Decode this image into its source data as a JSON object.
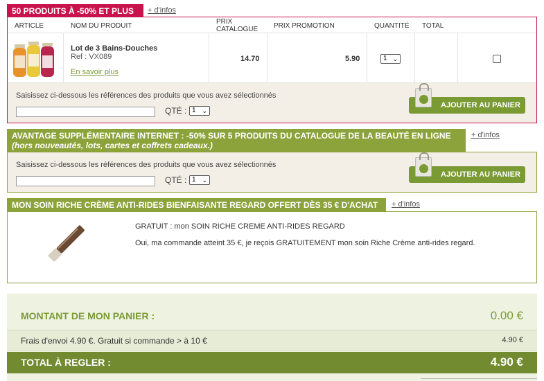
{
  "section1": {
    "tab_title": "50 PRODUITS À -50% ET PLUS",
    "more_link": "+ d'infos",
    "headers": {
      "article": "ARTICLE",
      "product_name": "NOM DU PRODUIT",
      "catalogue_price": "PRIX CATALOGUE",
      "promo_price": "PRIX PROMOTION",
      "quantity": "QUANTITÉ",
      "total": "TOTAL"
    },
    "product": {
      "name": "Lot de 3 Bains-Douches",
      "ref": "Ref : VX089",
      "learn_more": "En savoir plus",
      "catalogue_price": "14.70",
      "promo_price": "5.90",
      "quantity": "1"
    },
    "ref_hint": "Saisissez ci-dessous les références des produits que vous avez sélectionnés",
    "qty_label": "QTÉ :",
    "qty_value": "1",
    "add_button": "AJOUTER AU PANIER"
  },
  "section2": {
    "title_line1": "AVANTAGE SUPPLÉMENTAIRE INTERNET : -50% SUR 5 PRODUITS DU CATALOGUE DE LA BEAUTÉ EN LIGNE",
    "title_line2": "(hors nouveautés, lots, cartes et coffrets cadeaux.)",
    "more_link": "+ d'infos",
    "ref_hint": "Saisissez ci-dessous les références des produits que vous avez sélectionnés",
    "qty_label": "QTÉ :",
    "qty_value": "1",
    "add_button": "AJOUTER AU PANIER"
  },
  "section3": {
    "tab_title": "MON SOIN RICHE CRÈME ANTI-RIDES BIENFAISANTE REGARD OFFERT DÈS 35 € D'ACHAT",
    "more_link": "+ d'infos",
    "gift_title": "GRATUIT : mon SOIN RICHE CREME ANTI-RIDES REGARD",
    "gift_text": "Oui, ma commande atteint 35 €, je reçois GRATUITEMENT mon soin Riche Crème anti-rides regard."
  },
  "totals": {
    "basket_label": "MONTANT DE MON PANIER :",
    "basket_value": "0.00 €",
    "shipping_label": "Frais d'envoi 4.90 €. Gratuit si commande > à 10 €",
    "shipping_value": "4.90 €",
    "total_label": "TOTAL À REGLER :",
    "total_value": "4.90 €"
  },
  "colors": {
    "magenta": "#c8134e",
    "olive": "#8ca33c",
    "button_green": "#7a9a34",
    "beige": "#f4efe6",
    "totals_bg": "#eef3e1"
  }
}
